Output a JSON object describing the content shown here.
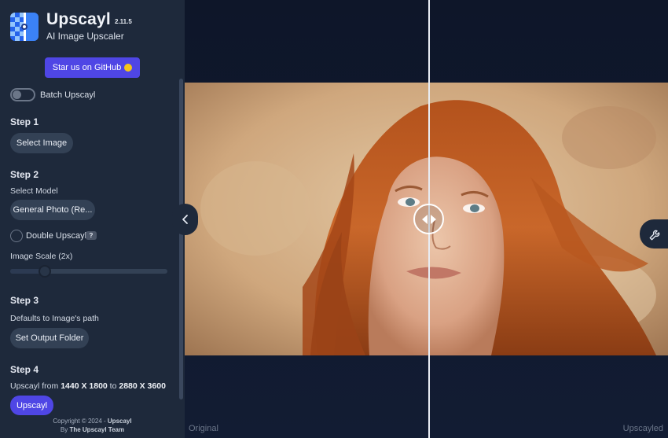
{
  "app": {
    "title": "Upscayl",
    "version": "2.11.5",
    "subtitle": "AI Image Upscaler"
  },
  "sidebar": {
    "github_button": "Star us on GitHub",
    "batch": {
      "label": "Batch Upscayl",
      "enabled": false
    },
    "step1": {
      "heading": "Step 1",
      "button": "Select Image"
    },
    "step2": {
      "heading": "Step 2",
      "model_label": "Select Model",
      "model_value": "General Photo (Re...",
      "double_label": "Double Upscayl",
      "help": "?",
      "scale_label": "Image Scale (2x)",
      "scale_value": 2,
      "scale_fraction": 0.22
    },
    "step3": {
      "heading": "Step 3",
      "info": "Defaults to Image's path",
      "button": "Set Output Folder"
    },
    "step4": {
      "heading": "Step 4",
      "prefix": "Upscayl from",
      "from": "1440 X 1800",
      "to_word": "to",
      "to": "2880 X 3600",
      "button": "Upscayl"
    },
    "copyright": {
      "line1_prefix": "Copyright © 2024 -",
      "line1_brand": "Upscayl",
      "line2_prefix": "By",
      "line2_team": "The Upscayl Team"
    }
  },
  "viewer": {
    "left_label": "Original",
    "right_label": "Upscayled",
    "split_fraction": 0.505
  },
  "icons": {
    "collapse": "chevron-left-icon",
    "settings": "wrench-icon",
    "handle": "arrows-left-right-icon"
  },
  "colors": {
    "sidebar_bg": "#1e293b",
    "main_bg": "#0e1629",
    "accent": "#4f46e5",
    "pill_bg": "#334155"
  }
}
